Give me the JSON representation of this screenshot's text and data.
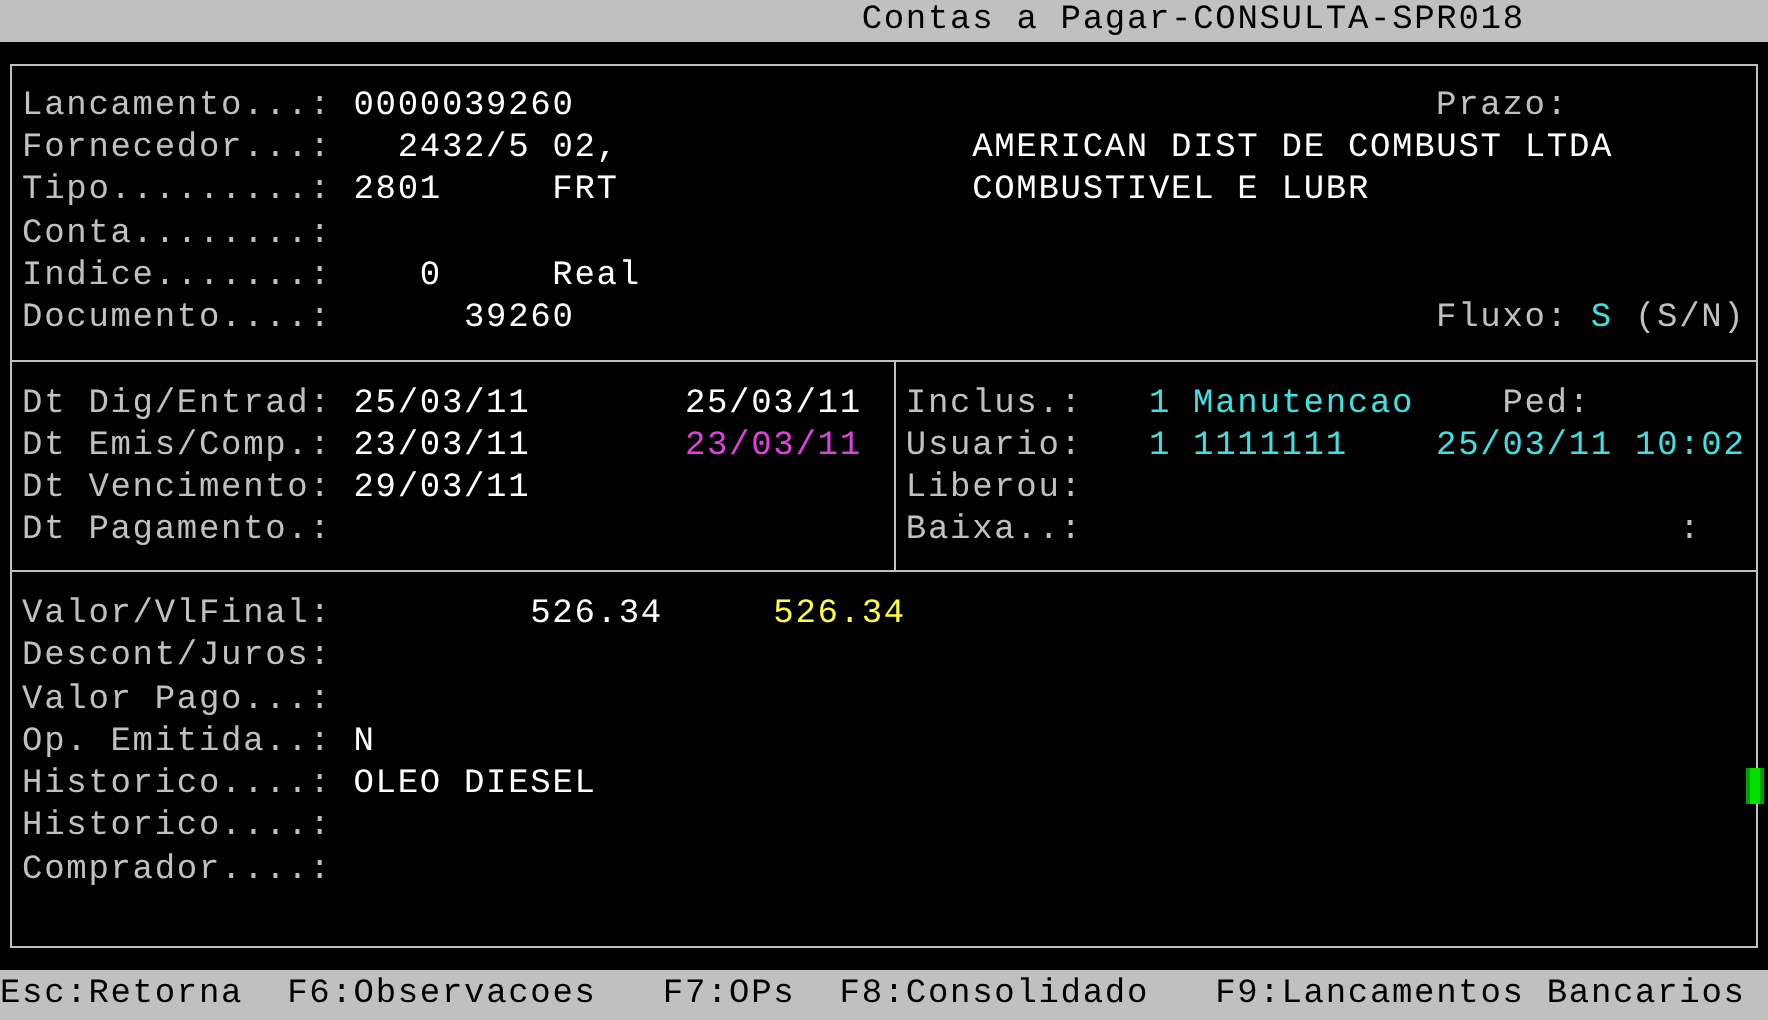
{
  "title_bar": {
    "title": "Contas a Pagar-CONSULTA-SPR018"
  },
  "header": {
    "rows": [
      {
        "items": [
          {
            "kind": "label",
            "text": "Lancamento...:"
          },
          {
            "kind": "value",
            "text": "0000039260",
            "color": "#ffffff"
          },
          {
            "kind": "label",
            "text": "Prazo:"
          }
        ]
      },
      {
        "items": [
          {
            "kind": "label",
            "text": "Fornecedor...:"
          },
          {
            "kind": "value",
            "text": "2432/5 02,",
            "color": "#ffffff"
          },
          {
            "kind": "value",
            "text": "AMERICAN DIST DE COMBUST LTDA",
            "color": "#ffffff"
          }
        ]
      },
      {
        "items": [
          {
            "kind": "label",
            "text": "Tipo.........:"
          },
          {
            "kind": "value",
            "text": "2801",
            "color": "#ffffff"
          },
          {
            "kind": "value",
            "text": "FRT",
            "color": "#ffffff"
          },
          {
            "kind": "value",
            "text": "COMBUSTIVEL E LUBR",
            "color": "#ffffff"
          }
        ]
      },
      {
        "items": [
          {
            "kind": "label",
            "text": "Conta........:"
          }
        ]
      },
      {
        "items": [
          {
            "kind": "label",
            "text": "Indice.......:"
          },
          {
            "kind": "value",
            "text": "0",
            "color": "#ffffff"
          },
          {
            "kind": "value",
            "text": "Real",
            "color": "#ffffff"
          }
        ]
      },
      {
        "items": [
          {
            "kind": "label",
            "text": "Documento....:"
          },
          {
            "kind": "value",
            "text": "39260",
            "color": "#ffffff"
          },
          {
            "kind": "label",
            "text": "Fluxo:"
          },
          {
            "kind": "value",
            "text": "S",
            "color": "#40e0e0"
          },
          {
            "kind": "label",
            "text": "(S/N)"
          }
        ]
      }
    ]
  },
  "dates": {
    "rows": [
      {
        "items": [
          {
            "kind": "label",
            "text": "Dt Dig/Entrad:"
          },
          {
            "kind": "value",
            "text": "25/03/11",
            "color": "#ffffff"
          },
          {
            "kind": "value",
            "text": "25/03/11",
            "color": "#ffffff"
          },
          {
            "kind": "label",
            "text": "Inclus.:"
          },
          {
            "kind": "value",
            "text": "1 Manutencao",
            "color": "#40e0e0"
          },
          {
            "kind": "label",
            "text": "Ped:"
          }
        ]
      },
      {
        "items": [
          {
            "kind": "label",
            "text": "Dt Emis/Comp.:"
          },
          {
            "kind": "value",
            "text": "23/03/11",
            "color": "#ffffff"
          },
          {
            "kind": "value",
            "text": "23/03/11",
            "color": "#e040e0"
          },
          {
            "kind": "label",
            "text": "Usuario:"
          },
          {
            "kind": "value",
            "text": "1 1111111",
            "color": "#40e0e0"
          },
          {
            "kind": "value",
            "text": "25/03/11 10:02",
            "color": "#40e0e0"
          }
        ]
      },
      {
        "items": [
          {
            "kind": "label",
            "text": "Dt Vencimento:"
          },
          {
            "kind": "value",
            "text": "29/03/11",
            "color": "#ffffff"
          },
          {
            "kind": "label",
            "text": "Liberou:"
          }
        ]
      },
      {
        "items": [
          {
            "kind": "label",
            "text": "Dt Pagamento.:"
          },
          {
            "kind": "label",
            "text": "Baixa..:"
          },
          {
            "kind": "label",
            "text": ":"
          }
        ]
      }
    ]
  },
  "values": {
    "rows": [
      {
        "items": [
          {
            "kind": "label",
            "text": "Valor/VlFinal:"
          },
          {
            "kind": "value",
            "text": "526.34",
            "color": "#ffffff"
          },
          {
            "kind": "value",
            "text": "526.34",
            "color": "#ffff40"
          }
        ]
      },
      {
        "items": [
          {
            "kind": "label",
            "text": "Descont/Juros:"
          }
        ]
      },
      {
        "items": [
          {
            "kind": "label",
            "text": "Valor Pago...:"
          }
        ]
      },
      {
        "items": [
          {
            "kind": "label",
            "text": "Op. Emitida..:"
          },
          {
            "kind": "value",
            "text": "N",
            "color": "#ffffff"
          }
        ]
      },
      {
        "items": [
          {
            "kind": "label",
            "text": "Historico....:"
          },
          {
            "kind": "value",
            "text": "OLEO DIESEL",
            "color": "#ffffff"
          }
        ]
      },
      {
        "items": [
          {
            "kind": "label",
            "text": "Historico....:"
          }
        ]
      },
      {
        "items": [
          {
            "kind": "label",
            "text": "Comprador....:"
          }
        ]
      }
    ]
  },
  "footer": {
    "keys": [
      "Esc:Retorna",
      "F6:Observacoes",
      "F7:OPs",
      "F8:Consolidado",
      "F9:Lancamentos Bancarios"
    ]
  }
}
